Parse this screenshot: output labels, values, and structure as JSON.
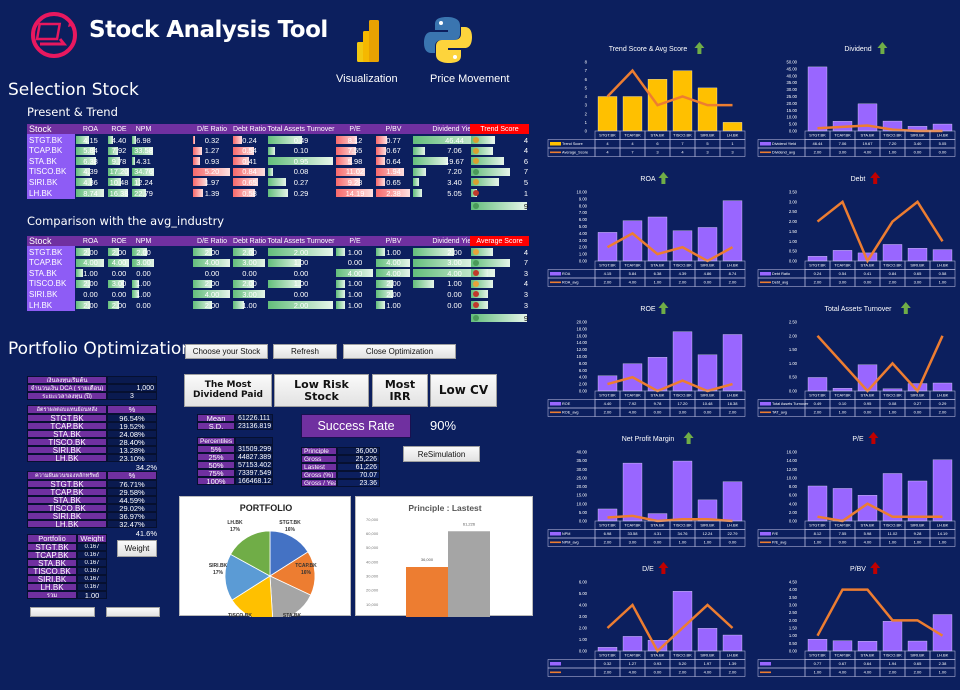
{
  "header": {
    "title": "Stock Analysis Tool",
    "links": [
      {
        "label": "Visualization",
        "icon": "power-bi-icon"
      },
      {
        "label": "Price Movement",
        "icon": "python-icon"
      }
    ]
  },
  "selection": {
    "title": "Selection Stock",
    "present_title": "Present & Trend",
    "comparison_title": "Comparison with the avg_industry",
    "columns": [
      "Stock",
      "ROA",
      "ROE",
      "NPM",
      "D/E Ratio",
      "Debt Ratio",
      "Total Assets Turnover",
      "P/E",
      "P/BV",
      "Dividend Yield"
    ],
    "stocks": [
      "STGT.BK",
      "TCAP.BK",
      "STA.BK",
      "TISCO.BK",
      "SIRI.BK",
      "LH.BK"
    ],
    "present": {
      "score_header": "Trend Score",
      "metric_colors": [
        "green",
        "green",
        "green",
        "red",
        "red",
        "green",
        "red",
        "red",
        "green"
      ],
      "rows": [
        [
          4.15,
          4.4,
          6.98,
          0.32,
          0.24,
          0.49,
          8.12,
          0.77,
          46.44
        ],
        [
          5.84,
          7.92,
          33.58,
          1.27,
          0.54,
          0.1,
          7.55,
          0.67,
          7.06
        ],
        [
          6.38,
          9.78,
          4.31,
          0.93,
          0.41,
          0.95,
          5.98,
          0.64,
          19.67
        ],
        [
          4.39,
          17.2,
          34.76,
          5.2,
          0.84,
          0.08,
          11.02,
          1.94,
          7.2
        ],
        [
          4.86,
          10.48,
          12.24,
          1.97,
          0.65,
          0.27,
          9.28,
          0.65,
          3.4
        ],
        [
          8.74,
          16.38,
          22.79,
          1.39,
          0.58,
          0.29,
          14.19,
          2.38,
          5.05
        ]
      ],
      "scores": [
        4,
        4,
        6,
        7,
        5,
        1
      ],
      "score_icons": [
        "arrow-diagonal",
        "arrow-diagonal",
        "arrow-diagonal",
        "arrow-up",
        "arrow-diagonal",
        "arrow-down"
      ],
      "total": 9
    },
    "comparison": {
      "score_header": "Average Score",
      "rows": [
        [
          2,
          2,
          2,
          2,
          2,
          2,
          1,
          1,
          2
        ],
        [
          4,
          4,
          3,
          4,
          3,
          1,
          0,
          4,
          3
        ],
        [
          1,
          0,
          0,
          0,
          0,
          0,
          4,
          4,
          4
        ],
        [
          2,
          3,
          1,
          2,
          2,
          1,
          1,
          2,
          1
        ],
        [
          0,
          0,
          1,
          4,
          3,
          0,
          1,
          2,
          0
        ],
        [
          2,
          2,
          0,
          2,
          1,
          2,
          1,
          1,
          0
        ]
      ],
      "scores": [
        4,
        7,
        3,
        4,
        3,
        3
      ],
      "score_icons": [
        "warning",
        "check",
        "cross",
        "warning",
        "cross",
        "cross"
      ],
      "total": 9
    }
  },
  "portfolio": {
    "title": "Portfolio Optimization",
    "buttons": {
      "choose": "Choose your Stock",
      "refresh": "Refresh",
      "close": "Close Optimization",
      "weight": "Weight",
      "resim": "ReSimulation"
    },
    "strategies": [
      "The Most Dividend Paid",
      "Low Risk Stock",
      "Most IRR",
      "Low CV"
    ],
    "inputs": [
      {
        "label": "เงินลงทุนเริ่มต้น",
        "value": ""
      },
      {
        "label": "จำนวนเงิน DCA ( รายเดือน)",
        "value": "1,000"
      },
      {
        "label": "ระยะเวลาลงทุน (ปี)",
        "value": "3"
      }
    ],
    "returns": {
      "header": "อัตราผลตอบแทนย้อนหลัง",
      "unit": "%",
      "values": [
        "96.54%",
        "19.52%",
        "24.08%",
        "28.40%",
        "13.28%",
        "23.10%"
      ],
      "total": "34.2%"
    },
    "volatility": {
      "header": "ความผันผวนของหลักทรัพย์",
      "unit": "%",
      "values": [
        "76.71%",
        "29.58%",
        "44.59%",
        "29.02%",
        "36.97%",
        "32.47%"
      ],
      "total": "41.6%"
    },
    "weights": {
      "header": [
        "Portfolio",
        "Weight"
      ],
      "values": [
        "0.167",
        "0.167",
        "0.167",
        "0.167",
        "0.167",
        "0.167"
      ],
      "sum_label": "รวม",
      "sum": "1.00"
    },
    "stats": [
      {
        "label": "Mean",
        "value": "61226.111"
      },
      {
        "label": "S.D.",
        "value": "23136.819"
      }
    ],
    "percentiles": {
      "header": "Percentiles",
      "rows": [
        {
          "label": "5%",
          "value": "31509.299"
        },
        {
          "label": "25%",
          "value": "44827.389"
        },
        {
          "label": "50%",
          "value": "57153.402"
        },
        {
          "label": "75%",
          "value": "73397.549"
        },
        {
          "label": "100%",
          "value": "166468.12"
        }
      ]
    },
    "success_label": "Success Rate",
    "success_rate": "90%",
    "summary": [
      {
        "label": "Principle",
        "value": "36,000"
      },
      {
        "label": "Gross",
        "value": "25,226"
      },
      {
        "label": "Lastest",
        "value": "61,226"
      },
      {
        "label": "Gross (%)",
        "value": "70.07"
      },
      {
        "label": "Gross / Yea",
        "value": "23.36"
      }
    ]
  },
  "colors": {
    "background": "#0c1f5e",
    "purple": "#7030a0",
    "bar_purple": "#9966ff",
    "line_orange": "#ed7d31",
    "trend_yellow": "#ffc000",
    "good_green": "#63be7b",
    "bad_red": "#f8696b",
    "score_header_red": "#ff0000"
  },
  "chart_data": [
    {
      "type": "pie",
      "title": "PORTFOLIO",
      "labels": [
        "STGT.BK",
        "TCAP.BK",
        "STA.BK",
        "TISCO.BK",
        "SIRI.BK",
        "LH.BK"
      ],
      "values": [
        16,
        16,
        17,
        17,
        17,
        17
      ],
      "data_labels": [
        "16%",
        "16%",
        "",
        "",
        "17%",
        "17%"
      ],
      "colors": [
        "#4472c4",
        "#ed7d31",
        "#a5a5a5",
        "#ffc000",
        "#5b9bd5",
        "#70ad47"
      ]
    },
    {
      "type": "bar",
      "title": "Principle : Lastest",
      "categories": [
        "Principle",
        "Lastest"
      ],
      "values": [
        36000,
        61226
      ],
      "data_labels": [
        "36,000",
        "61,226"
      ],
      "ylim": [
        0,
        70000
      ],
      "yticks": [
        "10,000",
        "20,000",
        "30,000",
        "40,000",
        "50,000",
        "60,000",
        "70,000"
      ],
      "colors": [
        "#ed7d31",
        "#a5a5a5"
      ]
    },
    {
      "type": "bar",
      "title": "Trend Score & Avg Score",
      "indicator": "green",
      "categories": [
        "STGT.BK",
        "TCAP.BK",
        "STA.BK",
        "TISCO.BK",
        "SIRI.BK",
        "LH.BK"
      ],
      "series": [
        {
          "name": "Trend Score",
          "values": [
            4,
            4,
            6,
            7,
            5,
            1
          ]
        },
        {
          "name": "Average_Score",
          "values": [
            4,
            7,
            3,
            4,
            3,
            3
          ]
        }
      ],
      "ylim": [
        0,
        8
      ],
      "ystep": 1,
      "decimals": 0,
      "bar_color": "#ffc000"
    },
    {
      "type": "bar",
      "title": "Dividend",
      "indicator": "green",
      "categories": [
        "STGT.BK",
        "TCAP.BK",
        "STA.BK",
        "TISCO.BK",
        "SIRI.BK",
        "LH.BK"
      ],
      "series": [
        {
          "name": "Dividend Yield",
          "values": [
            46.44,
            7.06,
            19.67,
            7.2,
            3.4,
            5.05
          ]
        },
        {
          "name": "Dividend_avg",
          "values": [
            2,
            3,
            4,
            1,
            0,
            0
          ]
        }
      ],
      "ylim": [
        0,
        50
      ],
      "ystep": 5,
      "decimals": 2,
      "bar_color": "#9966ff"
    },
    {
      "type": "bar",
      "title": "ROA",
      "indicator": "green",
      "categories": [
        "STGT.BK",
        "TCAP.BK",
        "STA.BK",
        "TISCO.BK",
        "SIRI.BK",
        "LH.BK"
      ],
      "series": [
        {
          "name": "ROA",
          "values": [
            4.15,
            5.84,
            6.38,
            4.39,
            4.86,
            8.74
          ]
        },
        {
          "name": "ROA_avg",
          "values": [
            2,
            4,
            1,
            2,
            0,
            2
          ]
        }
      ],
      "ylim": [
        0,
        10
      ],
      "ystep": 1,
      "decimals": 2,
      "bar_color": "#9966ff"
    },
    {
      "type": "bar",
      "title": "Debt",
      "indicator": "red",
      "categories": [
        "STGT.BK",
        "TCAP.BK",
        "STA.BK",
        "TISCO.BK",
        "SIRI.BK",
        "LH.BK"
      ],
      "series": [
        {
          "name": "Debt Ratio",
          "values": [
            0.24,
            0.54,
            0.41,
            0.84,
            0.65,
            0.58
          ]
        },
        {
          "name": "Debt_avg",
          "values": [
            2,
            3,
            0,
            2,
            3,
            1
          ]
        }
      ],
      "ylim": [
        0,
        3.5
      ],
      "ystep": 0.5,
      "decimals": 2,
      "bar_color": "#9966ff"
    },
    {
      "type": "bar",
      "title": "ROE",
      "indicator": "green",
      "categories": [
        "STGT.BK",
        "TCAP.BK",
        "STA.BK",
        "TISCO.BK",
        "SIRI.BK",
        "LH.BK"
      ],
      "series": [
        {
          "name": "ROE",
          "values": [
            4.4,
            7.92,
            9.78,
            17.2,
            10.48,
            16.38
          ]
        },
        {
          "name": "ROE_avg",
          "values": [
            2,
            4,
            0,
            3,
            0,
            2
          ]
        }
      ],
      "ylim": [
        0,
        20
      ],
      "ystep": 2,
      "decimals": 2,
      "bar_color": "#9966ff"
    },
    {
      "type": "bar",
      "title": "Total Assets Turnover",
      "indicator": "green",
      "categories": [
        "STGT.BK",
        "TCAP.BK",
        "STA.BK",
        "TISCO.BK",
        "SIRI.BK",
        "LH.BK"
      ],
      "series": [
        {
          "name": "Total Assets Turnover",
          "values": [
            0.49,
            0.1,
            0.95,
            0.08,
            0.27,
            0.29
          ]
        },
        {
          "name": "TAT_avg",
          "values": [
            2,
            1,
            0,
            1,
            0,
            2
          ]
        }
      ],
      "ylim": [
        0,
        2.5
      ],
      "ystep": 0.5,
      "decimals": 2,
      "bar_color": "#9966ff"
    },
    {
      "type": "bar",
      "title": "Net Profit Margin",
      "indicator": "green",
      "categories": [
        "STGT.BK",
        "TCAP.BK",
        "STA.BK",
        "TISCO.BK",
        "SIRI.BK",
        "LH.BK"
      ],
      "series": [
        {
          "name": "NPM",
          "values": [
            6.98,
            33.58,
            4.31,
            34.76,
            12.24,
            22.79
          ]
        },
        {
          "name": "NPM_avg",
          "values": [
            2,
            3,
            0,
            1,
            1,
            0
          ]
        }
      ],
      "ylim": [
        0,
        40
      ],
      "ystep": 5,
      "decimals": 2,
      "bar_color": "#9966ff"
    },
    {
      "type": "bar",
      "title": "P/E",
      "indicator": "red",
      "categories": [
        "STGT.BK",
        "TCAP.BK",
        "STA.BK",
        "TISCO.BK",
        "SIRI.BK",
        "LH.BK"
      ],
      "series": [
        {
          "name": "P/E",
          "values": [
            8.12,
            7.55,
            5.98,
            11.02,
            9.28,
            14.19
          ]
        },
        {
          "name": "P/E_avg",
          "values": [
            1,
            0,
            4,
            1,
            1,
            1
          ]
        }
      ],
      "ylim": [
        0,
        16
      ],
      "ystep": 2,
      "decimals": 2,
      "bar_color": "#9966ff"
    },
    {
      "type": "bar",
      "title": "D/E",
      "indicator": "red",
      "categories": [
        "STGT.BK",
        "TCAP.BK",
        "STA.BK",
        "TISCO.BK",
        "SIRI.BK",
        "LH.BK"
      ],
      "series": [
        {
          "values": [
            0.32,
            1.27,
            0.93,
            5.2,
            1.97,
            1.39
          ]
        },
        {
          "values": [
            2,
            4,
            0,
            2,
            4,
            2
          ]
        }
      ],
      "ylim": [
        0,
        6
      ],
      "ystep": 1,
      "decimals": 2,
      "bar_color": "#9966ff"
    },
    {
      "type": "bar",
      "title": "P/BV",
      "indicator": "red",
      "categories": [
        "STGT.BK",
        "TCAP.BK",
        "STA.BK",
        "TISCO.BK",
        "SIRI.BK",
        "LH.BK"
      ],
      "series": [
        {
          "values": [
            0.77,
            0.67,
            0.64,
            1.94,
            0.65,
            2.38
          ]
        },
        {
          "values": [
            1,
            4,
            4,
            2,
            2,
            1
          ]
        }
      ],
      "ylim": [
        0,
        4.5
      ],
      "ystep": 0.5,
      "decimals": 2,
      "bar_color": "#9966ff"
    }
  ]
}
